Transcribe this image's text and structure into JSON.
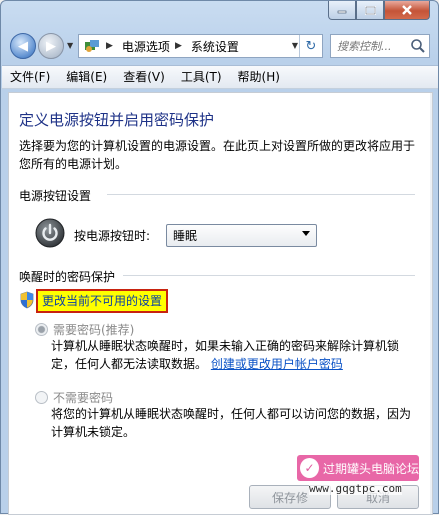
{
  "address": {
    "crumbs": [
      "电源选项",
      "系统设置"
    ],
    "search_placeholder": "搜索控制..."
  },
  "menu": [
    "文件(F)",
    "编辑(E)",
    "查看(V)",
    "工具(T)",
    "帮助(H)"
  ],
  "page": {
    "title": "定义电源按钮并启用密码保护",
    "description": "选择要为您的计算机设置的电源设置。在此页上对设置所做的更改将应用于您所有的电源计划。"
  },
  "power_buttons": {
    "section_label": "电源按钮设置",
    "label": "按电源按钮时:",
    "selected": "睡眠"
  },
  "wake_password": {
    "section_label": "唤醒时的密码保护",
    "change_link": "更改当前不可用的设置",
    "option_required": {
      "label": "需要密码(推荐)",
      "desc": "计算机从睡眠状态唤醒时，如果未输入正确的密码来解除计算机锁定，任何人都无法读取数据。",
      "link": "创建或更改用户帐户密码"
    },
    "option_not_required": {
      "label": "不需要密码",
      "desc": "将您的计算机从睡眠状态唤醒时，任何人都可以访问您的数据，因为计算机未锁定。"
    }
  },
  "buttons": {
    "save": "保存修",
    "cancel": "取消"
  },
  "watermark": {
    "text": "过期罐头电脑论坛",
    "url": "www.gqgtpc.com"
  }
}
